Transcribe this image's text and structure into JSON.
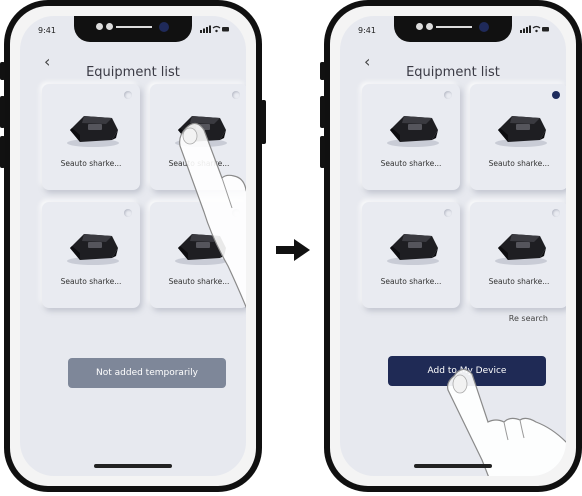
{
  "colors": {
    "screen_bg": "#e7e9ef",
    "accent_dark": "#1f2a55",
    "button_grey": "#7e8799"
  },
  "left_phone": {
    "status": {
      "time": "9:41",
      "icons": "signal-wifi-battery"
    },
    "title": "Equipment list",
    "devices": [
      {
        "label": "Seauto sharke...",
        "selected": false
      },
      {
        "label": "Seauto sharke...",
        "selected": false
      },
      {
        "label": "Seauto sharke...",
        "selected": false
      },
      {
        "label": "Seauto sharke...",
        "selected": false
      }
    ],
    "button": {
      "label": "Not added temporarily",
      "state": "disabled"
    }
  },
  "right_phone": {
    "status": {
      "time": "9:41",
      "icons": "signal-wifi-battery"
    },
    "title": "Equipment list",
    "devices": [
      {
        "label": "Seauto sharke...",
        "selected": false
      },
      {
        "label": "Seauto sharke...",
        "selected": true
      },
      {
        "label": "Seauto sharke...",
        "selected": false
      },
      {
        "label": "Seauto sharke...",
        "selected": false
      }
    ],
    "re_search": "Re search",
    "button": {
      "label": "Add to My Device",
      "state": "enabled"
    }
  }
}
